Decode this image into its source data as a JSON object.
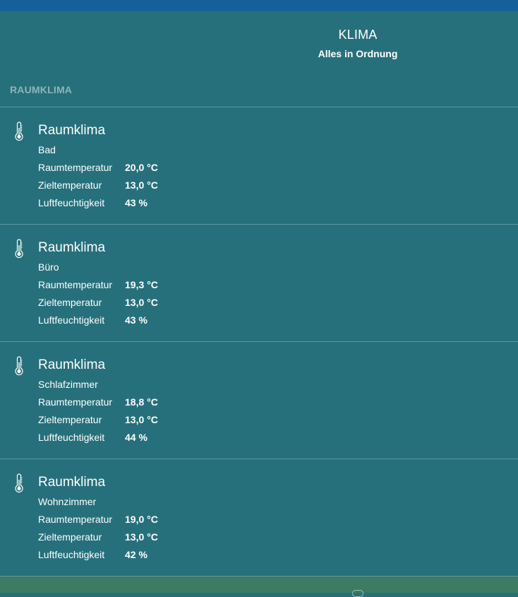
{
  "header": {
    "title": "KLIMA",
    "status": "Alles in Ordnung"
  },
  "section": {
    "heading": "RAUMKLIMA"
  },
  "labels": {
    "room_temp": "Raumtemperatur",
    "target_temp": "Zieltemperatur",
    "humidity": "Luftfeuchtigkeit"
  },
  "icons": {
    "device": "thermometer-icon"
  },
  "colors": {
    "background": "#26707b",
    "top_bar": "#15609b",
    "bottom_bar": "#3d7b62",
    "section_heading": "#8fb4ba"
  },
  "devices": [
    {
      "title": "Raumklima",
      "room": "Bad",
      "room_temp": "20,0 °C",
      "target_temp": "13,0 °C",
      "humidity": "43 %"
    },
    {
      "title": "Raumklima",
      "room": "Büro",
      "room_temp": "19,3 °C",
      "target_temp": "13,0 °C",
      "humidity": "43 %"
    },
    {
      "title": "Raumklima",
      "room": "Schlafzimmer",
      "room_temp": "18,8 °C",
      "target_temp": "13,0 °C",
      "humidity": "44 %"
    },
    {
      "title": "Raumklima",
      "room": "Wohnzimmer",
      "room_temp": "19,0 °C",
      "target_temp": "13,0 °C",
      "humidity": "42 %"
    }
  ]
}
